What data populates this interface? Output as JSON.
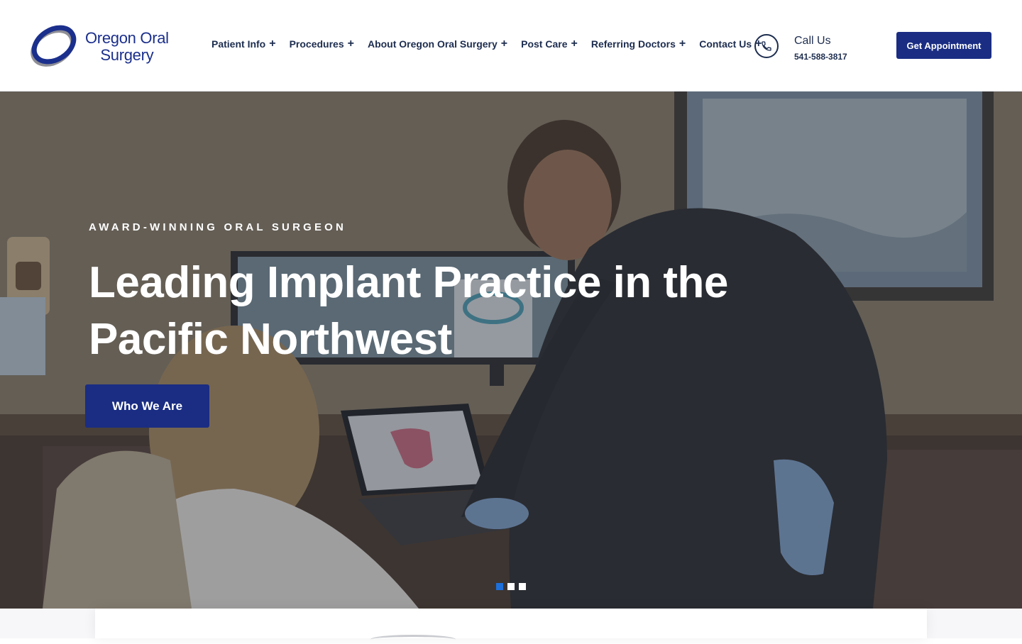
{
  "brand": {
    "line1": "Oregon Oral",
    "line2": "Surgery",
    "color": "#1b2f8c",
    "accent_gray": "#8e8e95"
  },
  "nav": {
    "items": [
      {
        "label": "Patient Info",
        "icon": "plus-icon"
      },
      {
        "label": "Procedures",
        "icon": "plus-icon"
      },
      {
        "label": "About Oregon Oral Surgery",
        "icon": "plus-icon"
      },
      {
        "label": "Post Care",
        "icon": "plus-icon"
      },
      {
        "label": "Referring Doctors",
        "icon": "plus-icon"
      },
      {
        "label": "Contact Us",
        "icon": "plus-icon"
      }
    ]
  },
  "call": {
    "icon": "phone-icon",
    "label": "Call Us",
    "number": "541-588-3817"
  },
  "header_cta": {
    "label": "Get Appointment",
    "color": "#1a2d83"
  },
  "hero": {
    "eyebrow": "AWARD-WINNING ORAL SURGEON",
    "headline": "Leading Implant Practice in the Pacific Northwest",
    "button_label": "Who We Are",
    "slides_total": 3,
    "active_slide": 1,
    "active_dot_color": "#1e6fd9"
  }
}
